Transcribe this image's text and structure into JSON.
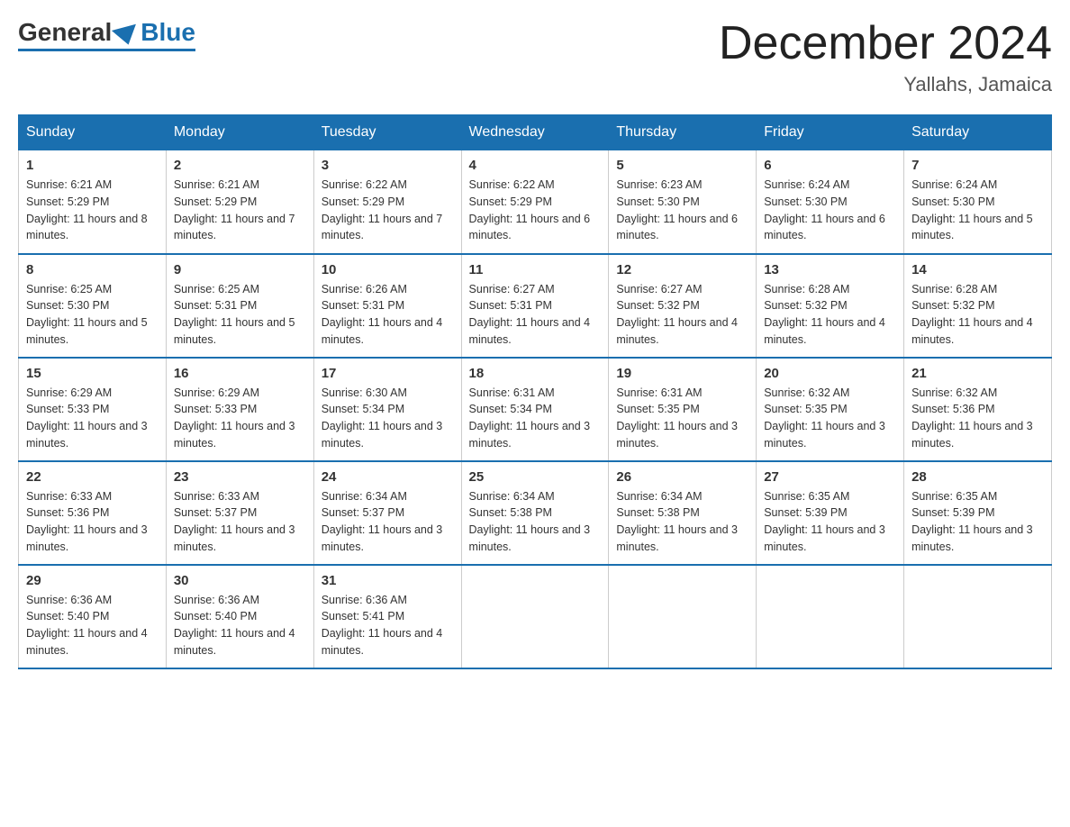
{
  "header": {
    "logo_general": "General",
    "logo_blue": "Blue",
    "title": "December 2024",
    "location": "Yallahs, Jamaica"
  },
  "weekdays": [
    "Sunday",
    "Monday",
    "Tuesday",
    "Wednesday",
    "Thursday",
    "Friday",
    "Saturday"
  ],
  "weeks": [
    [
      {
        "day": "1",
        "sunrise": "6:21 AM",
        "sunset": "5:29 PM",
        "daylight": "11 hours and 8 minutes."
      },
      {
        "day": "2",
        "sunrise": "6:21 AM",
        "sunset": "5:29 PM",
        "daylight": "11 hours and 7 minutes."
      },
      {
        "day": "3",
        "sunrise": "6:22 AM",
        "sunset": "5:29 PM",
        "daylight": "11 hours and 7 minutes."
      },
      {
        "day": "4",
        "sunrise": "6:22 AM",
        "sunset": "5:29 PM",
        "daylight": "11 hours and 6 minutes."
      },
      {
        "day": "5",
        "sunrise": "6:23 AM",
        "sunset": "5:30 PM",
        "daylight": "11 hours and 6 minutes."
      },
      {
        "day": "6",
        "sunrise": "6:24 AM",
        "sunset": "5:30 PM",
        "daylight": "11 hours and 6 minutes."
      },
      {
        "day": "7",
        "sunrise": "6:24 AM",
        "sunset": "5:30 PM",
        "daylight": "11 hours and 5 minutes."
      }
    ],
    [
      {
        "day": "8",
        "sunrise": "6:25 AM",
        "sunset": "5:30 PM",
        "daylight": "11 hours and 5 minutes."
      },
      {
        "day": "9",
        "sunrise": "6:25 AM",
        "sunset": "5:31 PM",
        "daylight": "11 hours and 5 minutes."
      },
      {
        "day": "10",
        "sunrise": "6:26 AM",
        "sunset": "5:31 PM",
        "daylight": "11 hours and 4 minutes."
      },
      {
        "day": "11",
        "sunrise": "6:27 AM",
        "sunset": "5:31 PM",
        "daylight": "11 hours and 4 minutes."
      },
      {
        "day": "12",
        "sunrise": "6:27 AM",
        "sunset": "5:32 PM",
        "daylight": "11 hours and 4 minutes."
      },
      {
        "day": "13",
        "sunrise": "6:28 AM",
        "sunset": "5:32 PM",
        "daylight": "11 hours and 4 minutes."
      },
      {
        "day": "14",
        "sunrise": "6:28 AM",
        "sunset": "5:32 PM",
        "daylight": "11 hours and 4 minutes."
      }
    ],
    [
      {
        "day": "15",
        "sunrise": "6:29 AM",
        "sunset": "5:33 PM",
        "daylight": "11 hours and 3 minutes."
      },
      {
        "day": "16",
        "sunrise": "6:29 AM",
        "sunset": "5:33 PM",
        "daylight": "11 hours and 3 minutes."
      },
      {
        "day": "17",
        "sunrise": "6:30 AM",
        "sunset": "5:34 PM",
        "daylight": "11 hours and 3 minutes."
      },
      {
        "day": "18",
        "sunrise": "6:31 AM",
        "sunset": "5:34 PM",
        "daylight": "11 hours and 3 minutes."
      },
      {
        "day": "19",
        "sunrise": "6:31 AM",
        "sunset": "5:35 PM",
        "daylight": "11 hours and 3 minutes."
      },
      {
        "day": "20",
        "sunrise": "6:32 AM",
        "sunset": "5:35 PM",
        "daylight": "11 hours and 3 minutes."
      },
      {
        "day": "21",
        "sunrise": "6:32 AM",
        "sunset": "5:36 PM",
        "daylight": "11 hours and 3 minutes."
      }
    ],
    [
      {
        "day": "22",
        "sunrise": "6:33 AM",
        "sunset": "5:36 PM",
        "daylight": "11 hours and 3 minutes."
      },
      {
        "day": "23",
        "sunrise": "6:33 AM",
        "sunset": "5:37 PM",
        "daylight": "11 hours and 3 minutes."
      },
      {
        "day": "24",
        "sunrise": "6:34 AM",
        "sunset": "5:37 PM",
        "daylight": "11 hours and 3 minutes."
      },
      {
        "day": "25",
        "sunrise": "6:34 AM",
        "sunset": "5:38 PM",
        "daylight": "11 hours and 3 minutes."
      },
      {
        "day": "26",
        "sunrise": "6:34 AM",
        "sunset": "5:38 PM",
        "daylight": "11 hours and 3 minutes."
      },
      {
        "day": "27",
        "sunrise": "6:35 AM",
        "sunset": "5:39 PM",
        "daylight": "11 hours and 3 minutes."
      },
      {
        "day": "28",
        "sunrise": "6:35 AM",
        "sunset": "5:39 PM",
        "daylight": "11 hours and 3 minutes."
      }
    ],
    [
      {
        "day": "29",
        "sunrise": "6:36 AM",
        "sunset": "5:40 PM",
        "daylight": "11 hours and 4 minutes."
      },
      {
        "day": "30",
        "sunrise": "6:36 AM",
        "sunset": "5:40 PM",
        "daylight": "11 hours and 4 minutes."
      },
      {
        "day": "31",
        "sunrise": "6:36 AM",
        "sunset": "5:41 PM",
        "daylight": "11 hours and 4 minutes."
      },
      null,
      null,
      null,
      null
    ]
  ]
}
